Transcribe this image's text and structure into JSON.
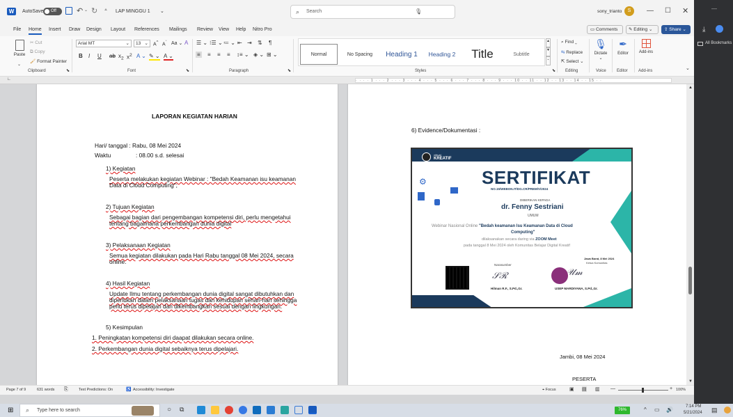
{
  "titlebar": {
    "autosave_label": "AutoSave",
    "autosave_state": "Off",
    "doc_name": "LAP MINGGU 1",
    "search_placeholder": "Search",
    "user": "sony_trianto",
    "user_initial": "S"
  },
  "menu": {
    "tabs": [
      "File",
      "Home",
      "Insert",
      "Draw",
      "Design",
      "Layout",
      "References",
      "Mailings",
      "Review",
      "View",
      "Help",
      "Nitro Pro"
    ],
    "comments": "Comments",
    "editing": "Editing",
    "share": "Share"
  },
  "ribbon": {
    "clipboard": {
      "paste": "Paste",
      "cut": "Cut",
      "copy": "Copy",
      "format_painter": "Format Painter",
      "label": "Clipboard"
    },
    "font": {
      "name": "Arial MT",
      "size": "13",
      "label": "Font"
    },
    "paragraph": {
      "label": "Paragraph"
    },
    "styles": {
      "items": [
        "Normal",
        "No Spacing",
        "Heading 1",
        "Heading 2",
        "Title",
        "Subtitle"
      ],
      "label": "Styles"
    },
    "editing": {
      "find": "Find",
      "replace": "Replace",
      "select": "Select",
      "label": "Editing"
    },
    "voice": {
      "dictate": "Dictate",
      "label": "Voice"
    },
    "editor": {
      "name": "Editor",
      "label": "Editor"
    },
    "addins": {
      "name": "Add-ins",
      "label": "Add-ins"
    }
  },
  "browser": {
    "bookmarks": "All Bookmarks"
  },
  "page1": {
    "title": "LAPORAN KEGIATAN HARIAN",
    "date_line": "Hari/ tanggal  : Rabu, 08 Mei 2024",
    "time_label": "Waktu",
    "time_value": ": 08.00 s.d. selesai",
    "s1_head": "1) Kegiatan",
    "s1_l1": "Peserta melakukan kegiatan Webinar : \"Bedah Keamanan isu keamanan",
    "s1_l2": "Data di Cloud Computing\";",
    "s2_head": "2) Tujuan Kegiatan",
    "s2_l1": "Sebagai bagian dari pengembangan kompetensi diri, perlu mengetahui",
    "s2_l2": "tentang bagaimana perkembangan dunia digital",
    "s3_head": "3) Pelaksanaan Kegiatan",
    "s3_l1": "Semua kegiatan dilakukan pada Hari Rabu tanggal 08 Mei 2024, secara",
    "s3_l2": "online.",
    "s4_head": "4) Hasil Kegiatan",
    "s4_l1": "Update Ilmu tentang perkembangan dunia digital sangat dibutuhkan dan",
    "s4_l2": "diperlukan dalam pelaksanaan tugas dan kehidupan sehari-hari sehingga",
    "s4_l3": "perlu terus dipelajari dan dikembangkan sesuai dengan lingkungan.",
    "s5_head": "5) Kesimpulan",
    "c1": "1.  Peningkatan kompetensi diri daapat dilakukan secara online.",
    "c2": "2.  Perkembangan dunia digital sebaiknya terus dipelajari."
  },
  "page2": {
    "evidence": "6) Evidence/Dokumentasi :",
    "place_date": "Jambi, 08 Mei 2024",
    "peserta": "PESERTA"
  },
  "certificate": {
    "brand": "KREATIF",
    "brand_small": "virtual",
    "title": "SERTIFIKAT",
    "number": "NO.15/WEBON.IT/DG.CR/PREM/V/2024",
    "given_to": "DIBERIKAN KEPADA",
    "recipient": "dr. Fenny Sestriani",
    "role": "UMUM",
    "line1_pre": "Webinar Nasional Online",
    "line1_bold": "\"Bedah keamanan Isu Keamanan Data di Cloud",
    "line2_bold": "Computing\"",
    "line3_pre": "dilaksanakan secara daring via",
    "line3_bold": "ZOOM Meet",
    "line4": "pada tanggal 8 Mei 2024 oleh Komunitas Belajar Digital Kreatif",
    "place": "Jawa Barat, 8 Mei 2024",
    "chair_title": "Ketua Komunitas",
    "speaker_title": "Narasumber",
    "speaker_name": "Hilman R.F., S.Pd.,Gr.",
    "chair_name": "USEP MARDIYANA, S.Pd.,Gr."
  },
  "status": {
    "page": "Page 7 of 9",
    "words": "631 words",
    "predictions": "Text Predictions: On",
    "accessibility": "Accessibility: Investigate",
    "focus": "Focus",
    "zoom": "100%"
  },
  "taskbar": {
    "search_placeholder": "Type here to search",
    "battery": "76%",
    "time": "7:14 PM",
    "date": "5/21/2024"
  },
  "colors": {
    "accent": "#185abd",
    "share": "#2b579a",
    "cert_dark": "#1b3a5c",
    "cert_teal": "#2cb5a8",
    "spell": "#d11"
  }
}
